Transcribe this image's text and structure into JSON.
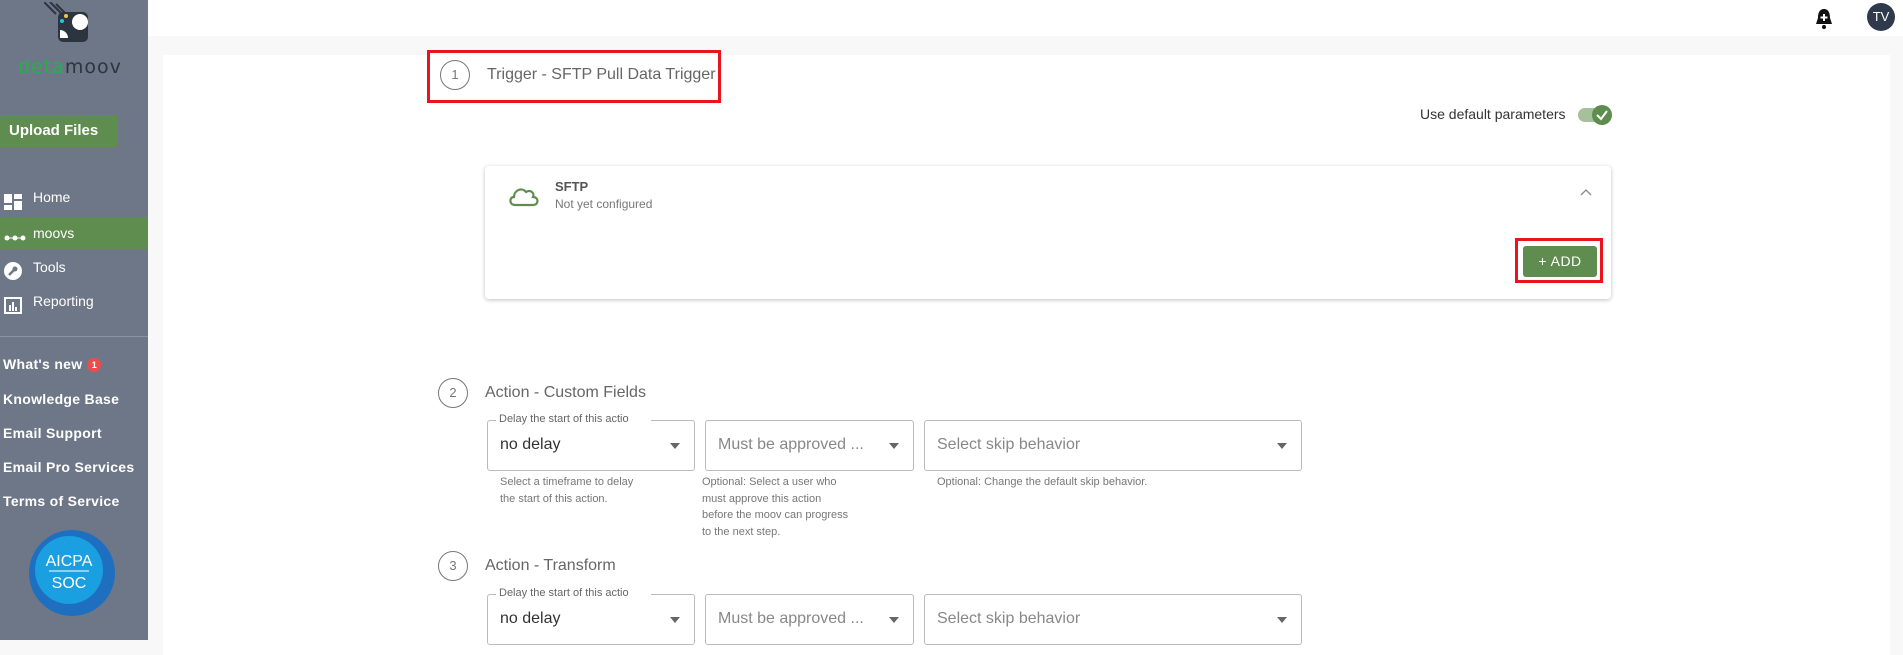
{
  "brand": {
    "logo_text_a": "deta",
    "logo_text_b": "moov",
    "soc_badge": "AICPA SOC"
  },
  "sidebar": {
    "upload": "Upload Files",
    "nav": [
      {
        "label": "Home"
      },
      {
        "label": "moovs"
      },
      {
        "label": "Tools"
      },
      {
        "label": "Reporting"
      }
    ],
    "links": [
      {
        "label": "What's new",
        "badge": "1"
      },
      {
        "label": "Knowledge Base"
      },
      {
        "label": "Email Support"
      },
      {
        "label": "Email Pro Services"
      },
      {
        "label": "Terms of Service"
      }
    ]
  },
  "header": {
    "avatar": "TV"
  },
  "steps": [
    {
      "num": "1",
      "title": "Trigger - SFTP Pull Data Trigger"
    },
    {
      "num": "2",
      "title": "Action - Custom Fields"
    },
    {
      "num": "3",
      "title": "Action - Transform"
    }
  ],
  "trigger": {
    "default_params": "Use default parameters",
    "default_params_on": true,
    "card_title": "SFTP",
    "card_status": "Not yet configured",
    "add": "+ ADD"
  },
  "fields": {
    "delay_label": "Delay the start of this actio",
    "delay_value": "no delay",
    "approve_ph": "Must be approved ...",
    "skip_ph": "Select skip behavior",
    "delay_help": "Select a timeframe to delay the start of this action.",
    "approve_help": "Optional: Select a user who must approve this action before the moov can progress to the next step.",
    "skip_help": "Optional: Change the default skip behavior."
  },
  "colors": {
    "accent": "#5f8c4f",
    "sidebar": "#6e7787",
    "highlight": "#e8141e"
  }
}
